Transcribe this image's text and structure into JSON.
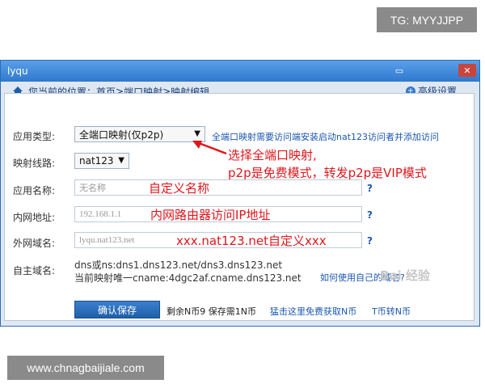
{
  "watermarks": {
    "top": "TG: MYYJJPP",
    "bottom": "www.chnagbaijiale.com"
  },
  "window": {
    "title": "lyqu",
    "buttons": {
      "minimize": "▭",
      "close": "✕"
    }
  },
  "breadcrumb": {
    "prefix": "您当前的位置：",
    "home": "首页",
    "sep1": " > ",
    "mid": "端口映射",
    "sep2": " > ",
    "current": "映射编辑",
    "advanced": "高级设置"
  },
  "form": {
    "app_type": {
      "label": "应用类型:",
      "value": "全端口映射(仅p2p)",
      "note": "全端口映射需要访问端安装启动nat123访问者并添加访问"
    },
    "line": {
      "label": "映射线路:",
      "value": "nat123"
    },
    "app_name": {
      "label": "应用名称:",
      "placeholder": "无名称",
      "annotation": "自定义名称"
    },
    "lan_addr": {
      "label": "内网地址:",
      "value": "192.168.1.1",
      "annotation": "内网路由器访问IP地址"
    },
    "wan_domain": {
      "label": "外网域名:",
      "value": "lyqu.nat123.net",
      "annotation": "xxx.nat123.net自定义xxx"
    },
    "custom_domain": {
      "label": "自主域名:",
      "line1": "dns或ns:dns1.dns123.net/dns3.dns123.net",
      "line2": "当前映射唯一cname:4dgc2af.cname.dns123.net",
      "help_link": "如何使用自己的域名?"
    }
  },
  "annotations": {
    "arrow_note_line1": "选择全端口映射,",
    "arrow_note_line2": "p2p是免费模式，转发p2p是VIP模式"
  },
  "footer": {
    "save_button": "确认保存",
    "balance_text": "剩余N币9 保存需1N币",
    "free_link": "猛击这里免费获取N币",
    "transfer_link": "T币转N币"
  },
  "baidu_watermark": "Bai 经验"
}
